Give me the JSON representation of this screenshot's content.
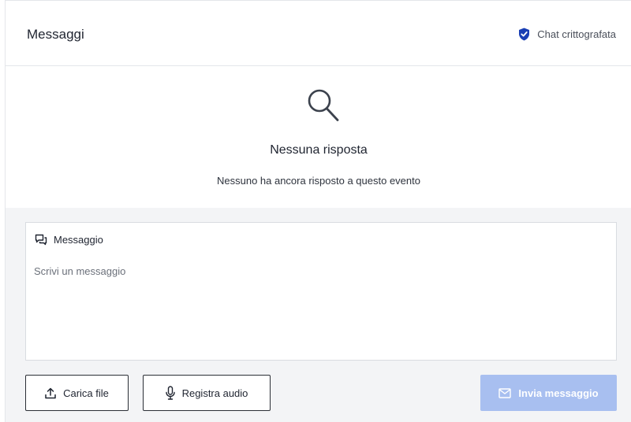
{
  "header": {
    "title": "Messaggi",
    "encryption_label": "Chat crittografata"
  },
  "empty_state": {
    "title": "Nessuna risposta",
    "subtitle": "Nessuno ha ancora risposto a questo evento"
  },
  "composer": {
    "label": "Messaggio",
    "placeholder": "Scrivi un messaggio",
    "value": ""
  },
  "actions": {
    "upload_label": "Carica file",
    "record_label": "Registra audio",
    "send_label": "Invia messaggio",
    "send_enabled": false
  },
  "colors": {
    "accent": "#1a3fb4",
    "send_disabled_bg": "#a8bff0",
    "composer_bg": "#f3f4f6"
  },
  "icons": {
    "encryption": "shield-check-icon",
    "empty_state": "search-icon",
    "composer_label": "chat-bubbles-icon",
    "upload": "upload-icon",
    "record": "microphone-icon",
    "send": "envelope-icon"
  }
}
